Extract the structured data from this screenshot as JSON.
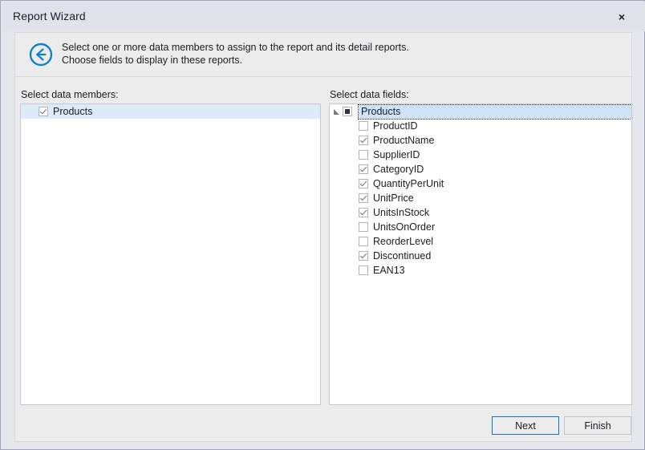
{
  "window": {
    "title": "Report Wizard",
    "close_label": "×"
  },
  "header": {
    "back_icon": "back-arrow-circle-icon",
    "description": "Select one or more data members to assign to the report and its detail reports.\nChoose fields to display in these reports."
  },
  "panels": {
    "members": {
      "label": "Select data members:",
      "items": [
        {
          "label": "Products",
          "checked": true,
          "selected": true
        }
      ]
    },
    "fields": {
      "label": "Select data fields:",
      "root": {
        "label": "Products",
        "state": "indeterminate",
        "selected": true,
        "expanded": true
      },
      "items": [
        {
          "label": "ProductID",
          "checked": false
        },
        {
          "label": "ProductName",
          "checked": true
        },
        {
          "label": "SupplierID",
          "checked": false
        },
        {
          "label": "CategoryID",
          "checked": true
        },
        {
          "label": "QuantityPerUnit",
          "checked": true
        },
        {
          "label": "UnitPrice",
          "checked": true
        },
        {
          "label": "UnitsInStock",
          "checked": true
        },
        {
          "label": "UnitsOnOrder",
          "checked": false
        },
        {
          "label": "ReorderLevel",
          "checked": false
        },
        {
          "label": "Discontinued",
          "checked": true
        },
        {
          "label": "EAN13",
          "checked": false
        }
      ]
    }
  },
  "footer": {
    "next_label": "Next",
    "finish_label": "Finish"
  },
  "colors": {
    "accent": "#0f74bc",
    "selection": "#cfe3f7",
    "selection_soft": "#ddeaf8",
    "window_bg": "#e6e6ed",
    "panel_bg": "#ececed"
  }
}
